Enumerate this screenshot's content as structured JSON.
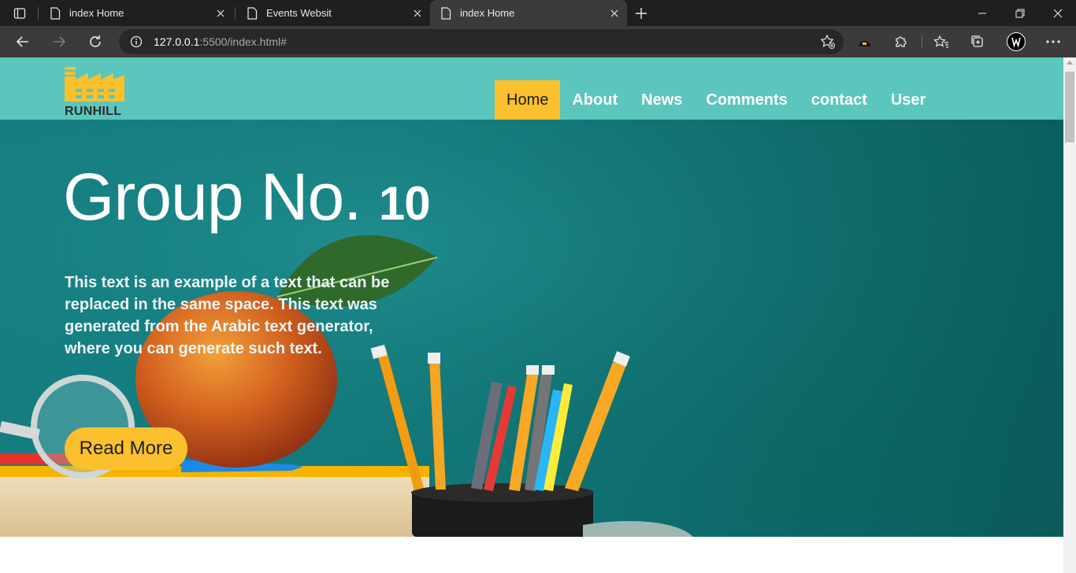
{
  "browser": {
    "tabs": [
      {
        "title": "index Home",
        "active": false
      },
      {
        "title": "Events Websit",
        "active": false
      },
      {
        "title": "index Home",
        "active": true
      }
    ],
    "address": {
      "host": "127.0.0.1",
      "rest": ":5500/index.html#"
    }
  },
  "site": {
    "logo_text": "RUNHILL",
    "nav": [
      {
        "label": "Home",
        "active": true
      },
      {
        "label": "About",
        "active": false
      },
      {
        "label": "News",
        "active": false
      },
      {
        "label": "Comments",
        "active": false
      },
      {
        "label": "contact",
        "active": false
      },
      {
        "label": "User",
        "active": false
      }
    ],
    "hero": {
      "title": "Group No.",
      "title_number": "10",
      "text": "This text is an example of a text that can be replaced in the same space. This text was generated from the Arabic text generator, where you can generate such text.",
      "button": "Read More"
    }
  },
  "colors": {
    "nav_bg": "#5bc6bd",
    "accent": "#fbc02d",
    "hero_bg": "#127c7e"
  }
}
